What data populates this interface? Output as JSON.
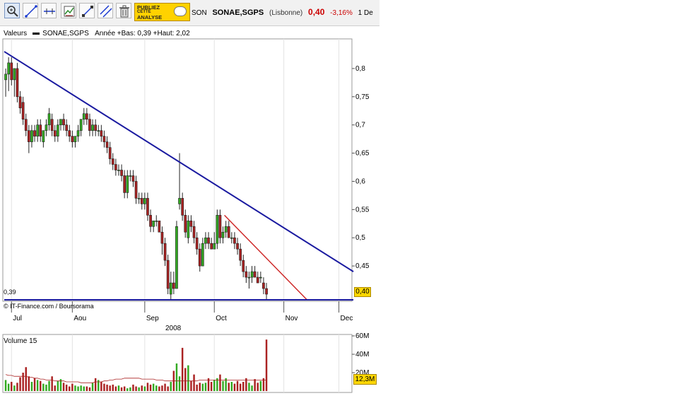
{
  "toolbar": {
    "tools": [
      "zoom-icon",
      "trendline-icon",
      "horizontal-line-icon",
      "indicator-icon",
      "line-segment-icon",
      "parallel-lines-icon",
      "trash-icon"
    ],
    "ad": {
      "line1": "PUBLIEZ",
      "line2": "CETTE",
      "line3": "ANALYSE"
    }
  },
  "quote": {
    "ticker": "SON",
    "name": "SONAE,SGPS",
    "market": "(Lisbonne)",
    "price": "0,40",
    "change": "-3,16%",
    "date": "1 De"
  },
  "legend": {
    "prefix": "Valeurs",
    "series": "SONAE,SGPS",
    "info": "Année +Bas: 0,39 +Haut: 2,02"
  },
  "colors": {
    "up": "#33aa22",
    "down": "#aa2222",
    "trend_major": "#1a1aa0",
    "trend_minor": "#cc2222",
    "support": "#1a1aa0",
    "volume_ma": "#aa2222"
  },
  "chart_data": [
    {
      "type": "candlestick",
      "series_name": "SONAE,SGPS",
      "xlabel": "2008",
      "x_ticks": [
        "Jul",
        "Aou",
        "Sep",
        "Oct",
        "Nov",
        "Dec"
      ],
      "y_ticks": [
        "0,8",
        "0,75",
        "0,7",
        "0,65",
        "0,6",
        "0,55",
        "0,5",
        "0,45"
      ],
      "ylim": [
        0.39,
        0.85
      ],
      "low_label": "0,39",
      "last_price": "0,40",
      "copyright": "© IT-Finance.com / Boursorama",
      "grid": "vertical",
      "candles": [
        [
          0.78,
          0.8,
          0.75,
          0.79
        ],
        [
          0.79,
          0.82,
          0.76,
          0.81
        ],
        [
          0.81,
          0.82,
          0.77,
          0.78
        ],
        [
          0.78,
          0.8,
          0.75,
          0.8
        ],
        [
          0.8,
          0.81,
          0.74,
          0.75
        ],
        [
          0.75,
          0.76,
          0.72,
          0.73
        ],
        [
          0.74,
          0.75,
          0.7,
          0.71
        ],
        [
          0.71,
          0.72,
          0.68,
          0.69
        ],
        [
          0.69,
          0.7,
          0.65,
          0.67
        ],
        [
          0.67,
          0.7,
          0.66,
          0.69
        ],
        [
          0.69,
          0.7,
          0.67,
          0.68
        ],
        [
          0.68,
          0.71,
          0.67,
          0.7
        ],
        [
          0.7,
          0.71,
          0.67,
          0.68
        ],
        [
          0.67,
          0.69,
          0.66,
          0.69
        ],
        [
          0.69,
          0.71,
          0.68,
          0.7
        ],
        [
          0.7,
          0.73,
          0.69,
          0.72
        ],
        [
          0.71,
          0.72,
          0.68,
          0.69
        ],
        [
          0.69,
          0.7,
          0.67,
          0.68
        ],
        [
          0.68,
          0.71,
          0.67,
          0.7
        ],
        [
          0.7,
          0.71,
          0.69,
          0.71
        ],
        [
          0.71,
          0.72,
          0.69,
          0.7
        ],
        [
          0.7,
          0.71,
          0.68,
          0.69
        ],
        [
          0.69,
          0.7,
          0.67,
          0.68
        ],
        [
          0.68,
          0.69,
          0.66,
          0.67
        ],
        [
          0.67,
          0.68,
          0.66,
          0.68
        ],
        [
          0.68,
          0.7,
          0.67,
          0.69
        ],
        [
          0.69,
          0.71,
          0.68,
          0.71
        ],
        [
          0.71,
          0.73,
          0.7,
          0.72
        ],
        [
          0.72,
          0.73,
          0.7,
          0.71
        ],
        [
          0.71,
          0.72,
          0.68,
          0.69
        ],
        [
          0.69,
          0.71,
          0.68,
          0.7
        ],
        [
          0.7,
          0.71,
          0.68,
          0.69
        ],
        [
          0.69,
          0.7,
          0.68,
          0.69
        ],
        [
          0.69,
          0.7,
          0.67,
          0.68
        ],
        [
          0.68,
          0.69,
          0.66,
          0.67
        ],
        [
          0.67,
          0.68,
          0.65,
          0.66
        ],
        [
          0.66,
          0.67,
          0.63,
          0.64
        ],
        [
          0.64,
          0.65,
          0.62,
          0.63
        ],
        [
          0.63,
          0.64,
          0.61,
          0.62
        ],
        [
          0.62,
          0.63,
          0.61,
          0.62
        ],
        [
          0.62,
          0.63,
          0.6,
          0.61
        ],
        [
          0.61,
          0.62,
          0.57,
          0.58
        ],
        [
          0.58,
          0.62,
          0.57,
          0.61
        ],
        [
          0.61,
          0.62,
          0.6,
          0.61
        ],
        [
          0.61,
          0.62,
          0.59,
          0.6
        ],
        [
          0.6,
          0.61,
          0.56,
          0.57
        ],
        [
          0.57,
          0.58,
          0.56,
          0.57
        ],
        [
          0.57,
          0.58,
          0.55,
          0.56
        ],
        [
          0.56,
          0.58,
          0.55,
          0.57
        ],
        [
          0.57,
          0.58,
          0.53,
          0.54
        ],
        [
          0.54,
          0.55,
          0.51,
          0.52
        ],
        [
          0.52,
          0.53,
          0.51,
          0.53
        ],
        [
          0.53,
          0.54,
          0.52,
          0.53
        ],
        [
          0.53,
          0.53,
          0.51,
          0.51
        ],
        [
          0.51,
          0.52,
          0.47,
          0.49
        ],
        [
          0.49,
          0.5,
          0.45,
          0.46
        ],
        [
          0.46,
          0.47,
          0.4,
          0.41
        ],
        [
          0.4,
          0.44,
          0.39,
          0.42
        ],
        [
          0.42,
          0.44,
          0.4,
          0.41
        ],
        [
          0.41,
          0.53,
          0.45,
          0.52
        ],
        [
          0.56,
          0.65,
          0.55,
          0.57
        ],
        [
          0.57,
          0.58,
          0.53,
          0.54
        ],
        [
          0.54,
          0.55,
          0.5,
          0.51
        ],
        [
          0.5,
          0.54,
          0.49,
          0.53
        ],
        [
          0.53,
          0.54,
          0.51,
          0.52
        ],
        [
          0.52,
          0.53,
          0.49,
          0.5
        ],
        [
          0.5,
          0.51,
          0.47,
          0.48
        ],
        [
          0.48,
          0.49,
          0.44,
          0.45
        ],
        [
          0.45,
          0.5,
          0.45,
          0.49
        ],
        [
          0.49,
          0.51,
          0.48,
          0.5
        ],
        [
          0.5,
          0.51,
          0.48,
          0.49
        ],
        [
          0.49,
          0.5,
          0.48,
          0.48
        ],
        [
          0.48,
          0.51,
          0.48,
          0.49
        ],
        [
          0.49,
          0.55,
          0.48,
          0.54
        ],
        [
          0.54,
          0.55,
          0.49,
          0.5
        ],
        [
          0.5,
          0.52,
          0.49,
          0.51
        ],
        [
          0.51,
          0.53,
          0.5,
          0.52
        ],
        [
          0.52,
          0.53,
          0.5,
          0.5
        ],
        [
          0.5,
          0.51,
          0.49,
          0.5
        ],
        [
          0.5,
          0.51,
          0.48,
          0.49
        ],
        [
          0.49,
          0.5,
          0.47,
          0.48
        ],
        [
          0.48,
          0.49,
          0.45,
          0.46
        ],
        [
          0.46,
          0.47,
          0.43,
          0.44
        ],
        [
          0.44,
          0.45,
          0.42,
          0.43
        ],
        [
          0.43,
          0.44,
          0.41,
          0.43
        ],
        [
          0.43,
          0.45,
          0.42,
          0.44
        ],
        [
          0.44,
          0.45,
          0.43,
          0.43
        ],
        [
          0.43,
          0.44,
          0.42,
          0.42
        ],
        [
          0.43,
          0.44,
          0.42,
          0.43
        ],
        [
          0.42,
          0.43,
          0.4,
          0.41
        ],
        [
          0.41,
          0.42,
          0.39,
          0.4
        ]
      ],
      "trendlines": [
        {
          "name": "major-resistance",
          "from": [
            0,
            0.83
          ],
          "to": [
            120,
            0.44
          ]
        },
        {
          "name": "minor-resistance",
          "from": [
            76,
            0.54
          ],
          "to": [
            104,
            0.39
          ]
        },
        {
          "name": "support",
          "from": [
            0,
            0.39
          ],
          "to": [
            120,
            0.39
          ]
        }
      ]
    },
    {
      "type": "bar",
      "title": "Volume 15",
      "y_ticks": [
        "60M",
        "40M",
        "20M"
      ],
      "ylim": [
        0,
        60
      ],
      "last_value": "12,3M",
      "values": [
        12,
        8,
        10,
        6,
        9,
        15,
        20,
        26,
        16,
        10,
        14,
        12,
        11,
        8,
        7,
        11,
        16,
        6,
        11,
        13,
        9,
        7,
        5,
        8,
        6,
        5,
        6,
        5,
        5,
        4,
        9,
        14,
        12,
        10,
        8,
        7,
        6,
        7,
        5,
        6,
        4,
        5,
        3,
        4,
        7,
        5,
        4,
        6,
        5,
        9,
        7,
        8,
        6,
        5,
        6,
        8,
        5,
        10,
        22,
        30,
        16,
        47,
        25,
        28,
        11,
        18,
        7,
        9,
        8,
        9,
        14,
        10,
        12,
        14,
        18,
        11,
        14,
        9,
        10,
        8,
        11,
        8,
        10,
        14,
        9,
        6,
        13,
        9,
        11,
        14,
        56
      ],
      "moving_average": [
        18,
        17,
        17,
        16,
        16,
        16,
        16,
        16,
        15,
        15,
        14,
        14,
        13,
        13,
        12,
        12,
        12,
        11,
        11,
        11,
        11,
        10,
        10,
        10,
        10,
        10,
        9,
        9,
        9,
        9,
        9,
        10,
        10,
        10,
        11,
        11,
        12,
        12,
        13,
        13,
        13,
        14,
        14,
        14,
        14,
        14,
        14,
        13,
        13,
        13,
        13,
        13,
        12,
        12,
        12,
        11,
        11,
        11,
        11,
        11,
        11,
        11,
        11,
        11,
        11,
        11,
        11,
        12,
        12,
        12,
        12,
        12,
        12,
        12,
        12,
        12,
        12,
        12,
        12,
        12,
        12,
        12,
        12,
        12,
        12,
        12,
        12,
        12,
        12,
        12,
        12
      ],
      "colors": [
        "#33aa22",
        "#aa2222"
      ]
    }
  ]
}
